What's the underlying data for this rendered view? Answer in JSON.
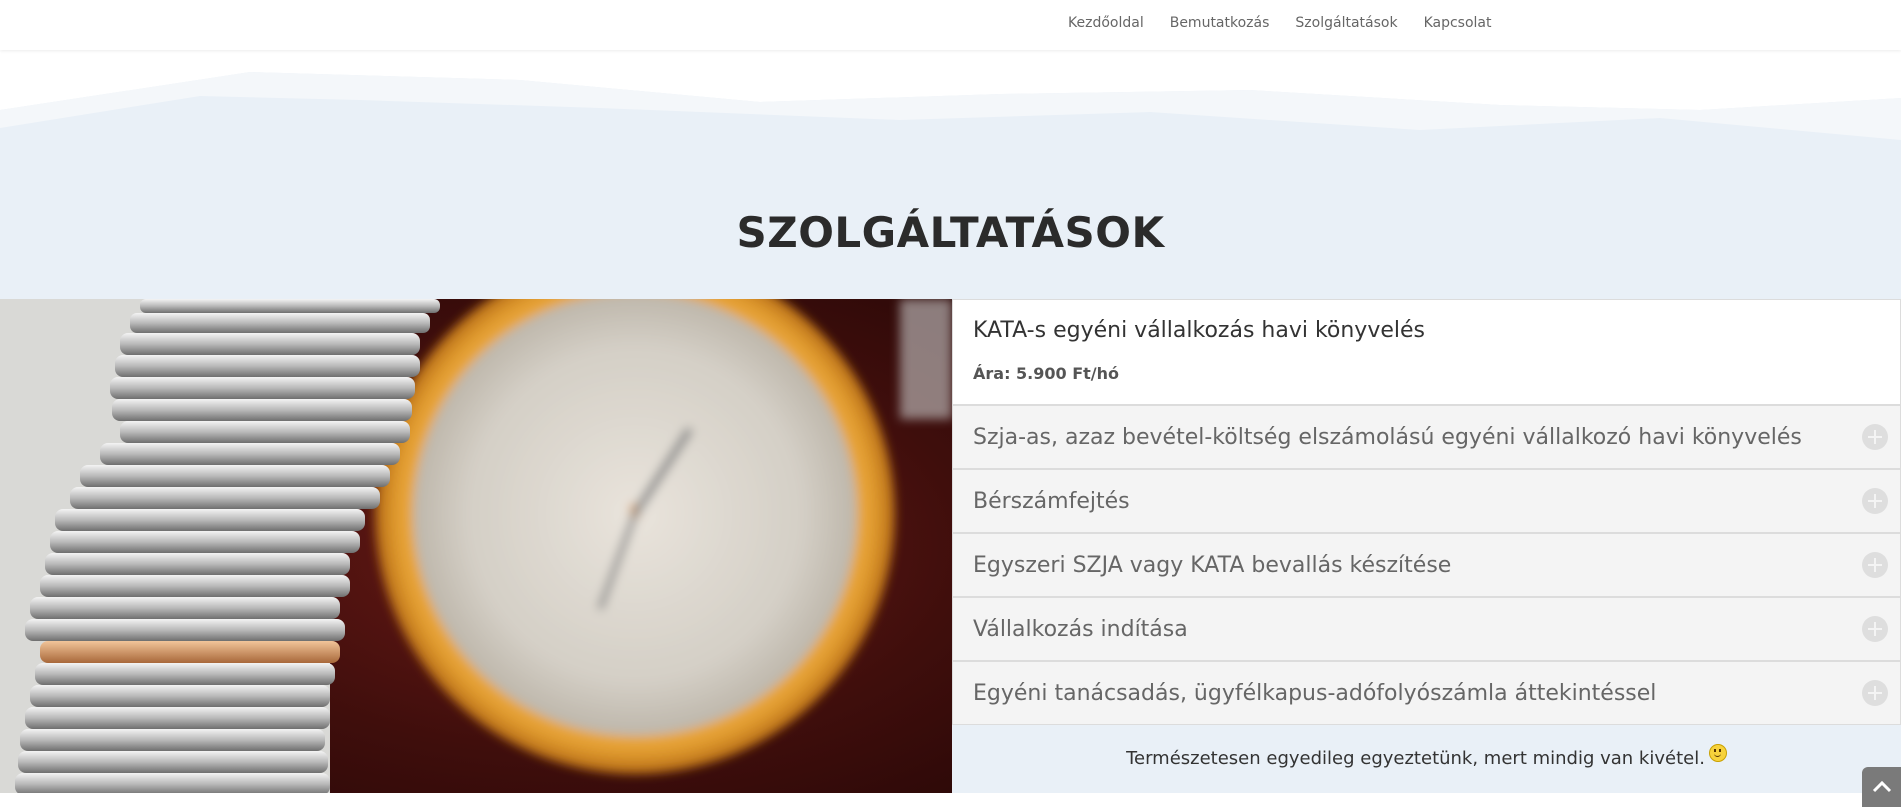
{
  "nav": {
    "items": [
      {
        "label": "Kezdőoldal"
      },
      {
        "label": "Bemutatkozás"
      },
      {
        "label": "Szolgáltatások"
      },
      {
        "label": "Kapcsolat"
      }
    ]
  },
  "hero": {
    "title": "SZOLGÁLTATÁSOK"
  },
  "image": {
    "icon": "coins-and-clock-photo"
  },
  "accordion": {
    "open": {
      "title": "KATA-s egyéni vállalkozás havi könyvelés",
      "price": "Ára: 5.900 Ft/hó"
    },
    "items": [
      {
        "title": "Szja-as, azaz bevétel-költség elszámolású egyéni vállalkozó havi könyvelés"
      },
      {
        "title": "Bérszámfejtés"
      },
      {
        "title": "Egyszeri SZJA vagy KATA bevallás készítése"
      },
      {
        "title": "Vállalkozás indítása"
      },
      {
        "title": "Egyéni tanácsadás, ügyfélkapus-adófolyószámla áttekintéssel"
      }
    ]
  },
  "note": {
    "text": "Természetesen egyedileg egyeztetünk, mert mindig van kivétel."
  },
  "colors": {
    "hero_bg": "#e9f0f7",
    "heading": "#2b2b2b",
    "accordion_closed_bg": "#f4f4f4"
  }
}
